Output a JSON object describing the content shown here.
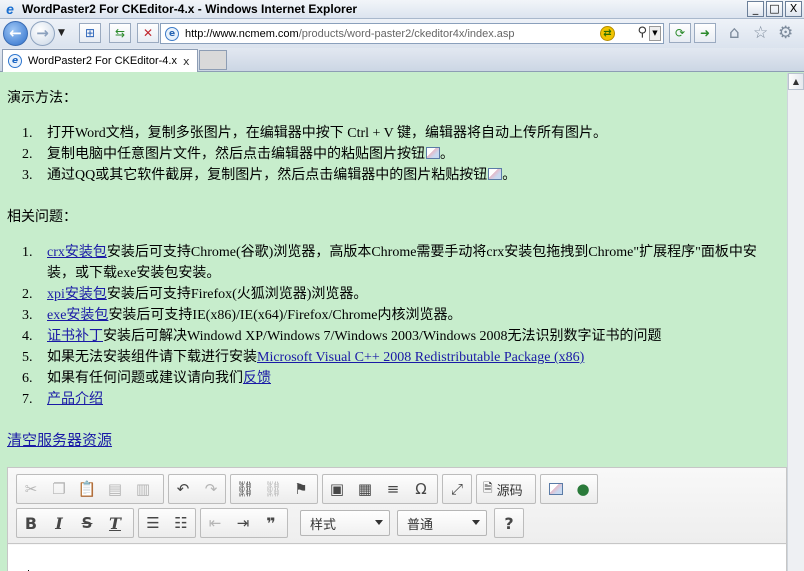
{
  "window": {
    "title": "WordPaster2 For CKEditor-4.x - Windows Internet Explorer",
    "logo_glyph": "e",
    "buttons": {
      "minimize": "_",
      "maximize": "□",
      "close": "X"
    }
  },
  "navbar": {
    "back_glyph": "←",
    "forward_glyph": "→",
    "address_host": "http://www.ncmem.com",
    "address_path": "/products/word-paster2/ckeditor4x/index.asp"
  },
  "tab": {
    "label": "WordPaster2 For CKEditor-4.x",
    "close": "x"
  },
  "content": {
    "demo_title": "演示方法：",
    "demo_steps": [
      {
        "num": "1.",
        "text": "打开Word文档，复制多张图片，在编辑器中按下 Ctrl + V 键，编辑器将自动上传所有图片。"
      },
      {
        "num": "2.",
        "text": "复制电脑中任意图片文件，然后点击编辑器中的粘贴图片按钮",
        "end": "。"
      },
      {
        "num": "3.",
        "text": "通过QQ或其它软件截屏，复制图片，然后点击编辑器中的图片粘贴按钮",
        "end": "。"
      }
    ],
    "faq_title": "相关问题：",
    "faq": [
      {
        "num": "1.",
        "link": "crx安装包",
        "text": "安装后可支持Chrome(谷歌)浏览器，高版本Chrome需要手动将crx安装包拖拽到Chrome\"扩展程序\"面板中安装，或下载exe安装包安装。"
      },
      {
        "num": "2.",
        "link": "xpi安装包",
        "text": "安装后可支持Firefox(火狐浏览器)浏览器。"
      },
      {
        "num": "3.",
        "link": "exe安装包",
        "text": "安装后可支持IE(x86)/IE(x64)/Firefox/Chrome内核浏览器。"
      },
      {
        "num": "4.",
        "link": "证书补丁",
        "text": "安装后可解决Windowd XP/Windows 7/Windows 2003/Windows 2008无法识别数字证书的问题"
      },
      {
        "num": "5.",
        "pre": "如果无法安装组件请下载进行安装",
        "link": "Microsoft Visual C++ 2008 Redistributable Package (x86)"
      },
      {
        "num": "6.",
        "pre": "如果有任何问题或建议请向我们",
        "link": "反馈"
      },
      {
        "num": "7.",
        "link": "产品介绍"
      }
    ],
    "clear_link": "清空服务器资源"
  },
  "editor": {
    "source_label": "源码",
    "style_combo": "样式",
    "format_combo": "普通",
    "help_glyph": "?"
  }
}
